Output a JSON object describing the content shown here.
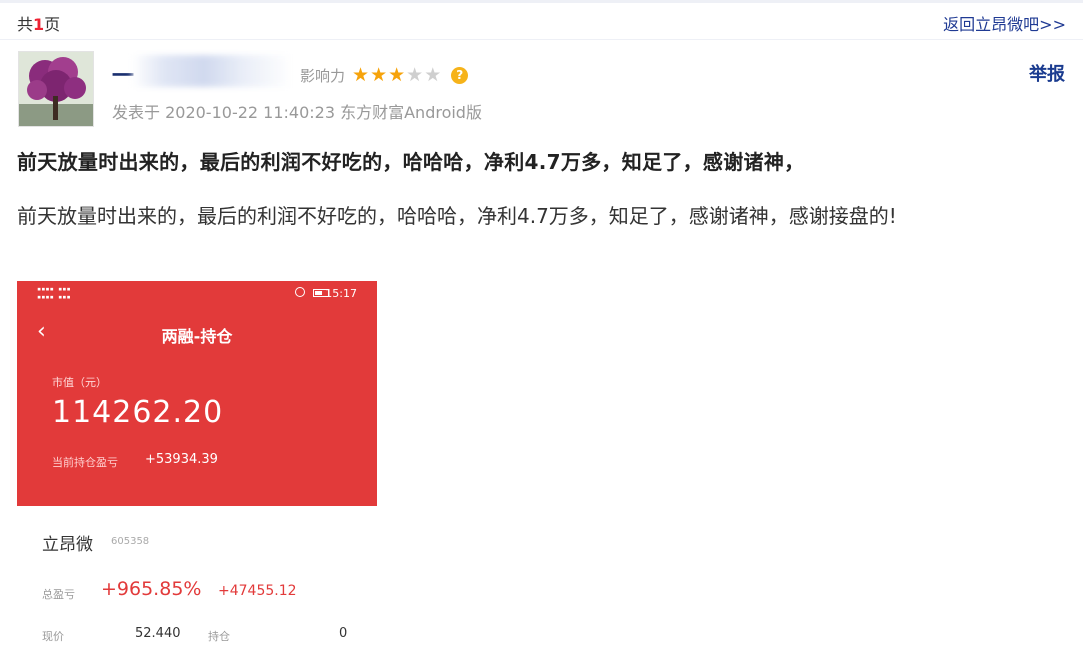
{
  "topbar": {
    "pages_prefix": "共",
    "pages_num": "1",
    "pages_suffix": "页",
    "back_link": "返回立昂微吧>>"
  },
  "post": {
    "author": "一",
    "influence_label": "影响力",
    "rating": 3,
    "rating_max": 5,
    "star_on_color": "#f6a30b",
    "report": "举报",
    "meta": "发表于 2020-10-22 11:40:23 东方财富Android版",
    "title": "前天放量时出来的，最后的利润不好吃的，哈哈哈，净利4.7万多，知足了，感谢诸神，",
    "body": "前天放量时出来的，最后的利润不好吃的，哈哈哈，净利4.7万多，知足了，感谢诸神，感谢接盘的!"
  },
  "screenshot": {
    "status_time": "15:17",
    "screen_title": "两融-持仓",
    "market_value_label": "市值（元）",
    "market_value": "114262.20",
    "position_pnl_label": "当前持仓盈亏",
    "position_pnl": "+53934.39",
    "stock_name": "立昂微",
    "stock_code": "605358",
    "total_pnl_label": "总盈亏",
    "total_pnl_pct": "+965.85%",
    "total_pnl_amount": "+47455.12",
    "price_label": "现价",
    "price": "52.440",
    "holding_label": "持仓",
    "holding": "0",
    "accent_color": "#e23a3a"
  }
}
